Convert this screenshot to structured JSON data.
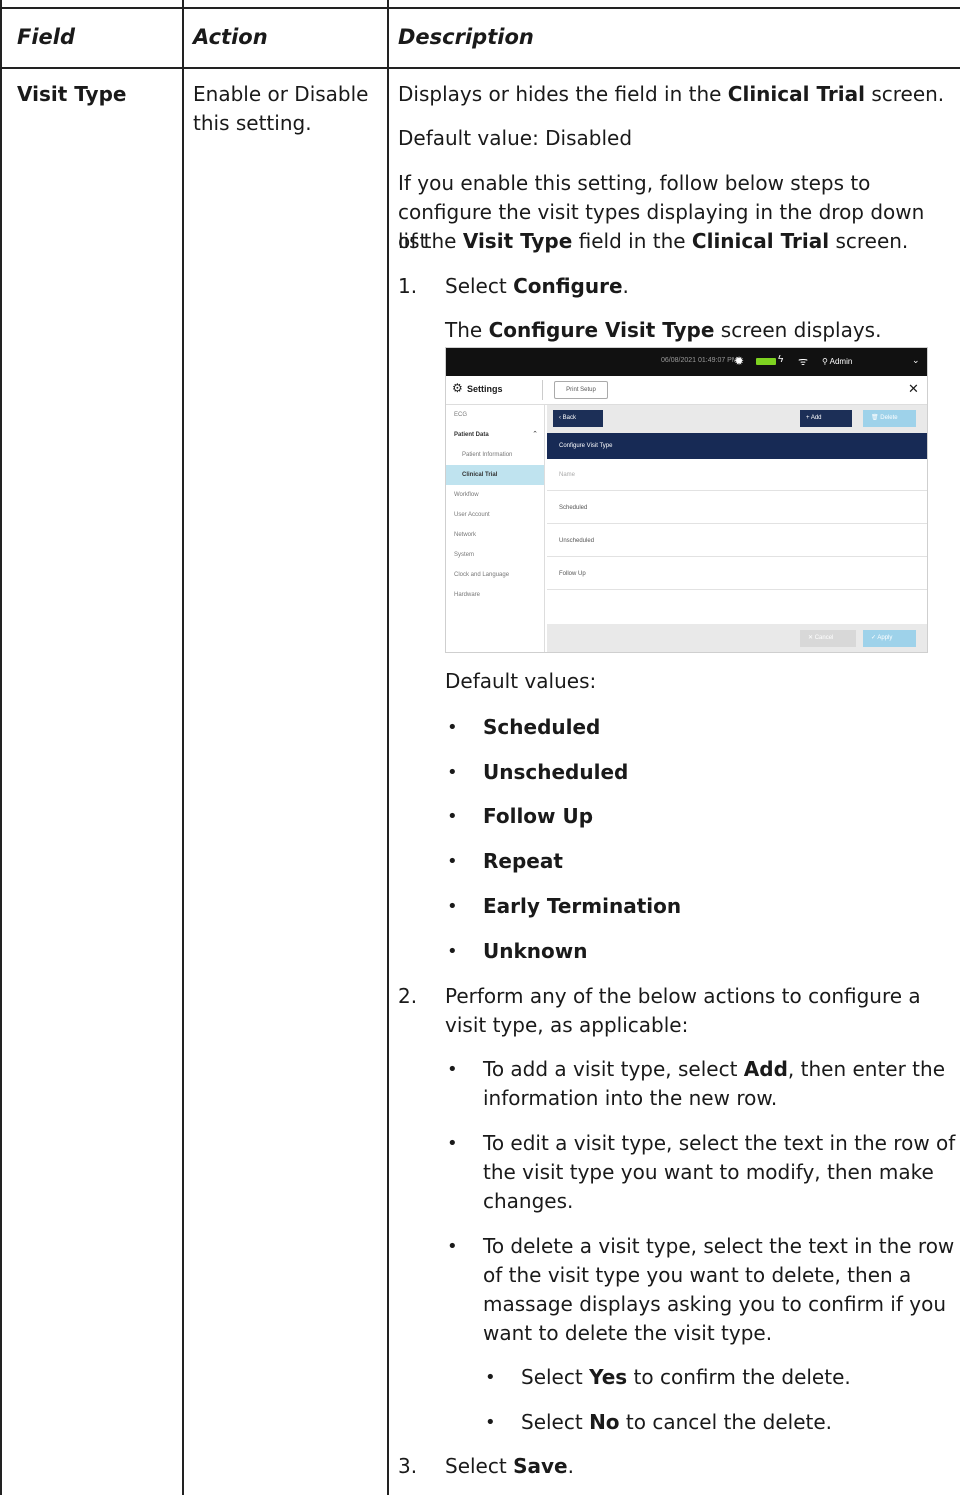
{
  "table": {
    "headers": {
      "field": "Field",
      "action": "Action",
      "description": "Description"
    },
    "row": {
      "field": "Visit Type",
      "action_line1": "Enable or Disable",
      "action_line2": "this setting."
    }
  },
  "desc": {
    "p1_pre": "Displays or hides the field in the ",
    "p1_bold": "Clinical Trial",
    "p1_post": " screen.",
    "p2": "Default value: Disabled",
    "p3_l1": "If you enable this setting, follow below steps to",
    "p3_l2": "configure the visit types displaying in the drop down list",
    "p3_l3_pre": "of the ",
    "p3_l3_b1": "Visit Type",
    "p3_l3_mid": " field in the ",
    "p3_l3_b2": "Clinical Trial",
    "p3_l3_post": " screen.",
    "step1_num": "1.",
    "step1_pre": "Select ",
    "step1_bold": "Configure",
    "step1_post": ".",
    "step1_sub_pre": "The ",
    "step1_sub_bold": "Configure Visit Type",
    "step1_sub_post": " screen displays.",
    "defaults_label": "Default values:",
    "defaults": [
      "Scheduled",
      "Unscheduled",
      "Follow Up",
      "Repeat",
      "Early Termination",
      "Unknown"
    ],
    "step2_num": "2.",
    "step2_l1": "Perform any of the below actions to configure a",
    "step2_l2": "visit type, as applicable:",
    "add_l1_pre": "To add a visit type, select ",
    "add_l1_bold": "Add",
    "add_l1_post": ", then enter the",
    "add_l2": "information into the new row.",
    "edit_l1": "To edit a visit type, select the text in the row of",
    "edit_l2": "the visit type you want to modify, then make",
    "edit_l3": "changes.",
    "del_l1": "To delete a visit type, select the text in the row",
    "del_l2": "of the visit type you want to delete, then a",
    "del_l3": "massage displays asking you to confirm if you",
    "del_l4": "want to delete the visit type.",
    "yes_pre": "Select ",
    "yes_bold": "Yes",
    "yes_post": " to confirm the delete.",
    "no_pre": "Select ",
    "no_bold": "No",
    "no_post": " to cancel the delete.",
    "step3_num": "3.",
    "step3_pre": "Select ",
    "step3_bold": "Save",
    "step3_post": "."
  },
  "screenshot": {
    "datetime": "06/08/2021 01:49:07 PM",
    "user": "Admin",
    "settings_title": "Settings",
    "print_setup": "Print Setup",
    "sidebar": [
      "ECG",
      "Patient Data",
      "Patient Information",
      "Clinical Trial",
      "Workflow",
      "User Account",
      "Network",
      "System",
      "Clock and Language",
      "Hardware"
    ],
    "back": "Back",
    "add": "Add",
    "delete": "Delete",
    "panel_title": "Configure Visit Type",
    "name_placeholder": "Name",
    "rows": [
      "Scheduled",
      "Unscheduled",
      "Follow Up"
    ],
    "cancel": "Cancel",
    "apply": "Apply"
  },
  "colors": {
    "nav_dark": "#172a55",
    "selected": "#bfe3ef",
    "battery": "#7ed321"
  }
}
